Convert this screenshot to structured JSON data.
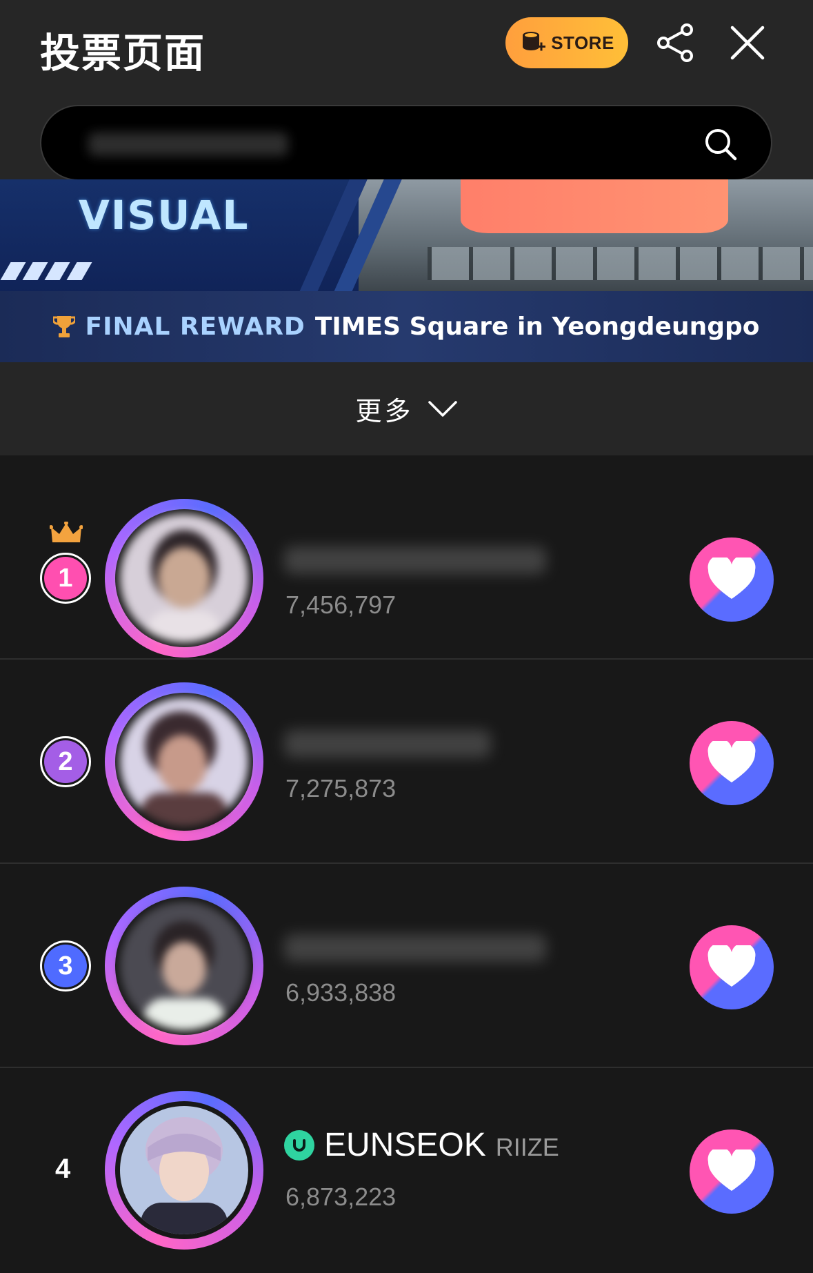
{
  "header": {
    "title": "投票页面",
    "store_label": "STORE",
    "store_icon": "coin-stack-plus-icon",
    "share_icon": "share-icon",
    "close_icon": "close-icon"
  },
  "search": {
    "placeholder": "",
    "icon": "search-icon"
  },
  "banner": {
    "visual_text": "VISUAL",
    "reward_label": "FINAL REWARD",
    "reward_text": "TIMES Square in Yeongdeungpo",
    "trophy_icon": "trophy-icon"
  },
  "more": {
    "label": "更多",
    "icon": "chevron-down-icon"
  },
  "ranking": [
    {
      "rank": "1",
      "votes": "7,456,797",
      "badge_color": "#ff4fb0",
      "name": "",
      "group": "",
      "crown": true
    },
    {
      "rank": "2",
      "votes": "7,275,873",
      "badge_color": "#a45ee6",
      "name": "",
      "group": ""
    },
    {
      "rank": "3",
      "votes": "6,933,838",
      "badge_color": "#4f6bff",
      "name": "",
      "group": ""
    },
    {
      "rank": "4",
      "votes": "6,873,223",
      "name": "EUNSEOK",
      "group": "RIIZE"
    }
  ],
  "colors": {
    "heart_pink": "#ff55b3",
    "heart_blue": "#5a6cff",
    "store_orange": "#ffaa3a",
    "verified_green": "#2fd4a0"
  }
}
